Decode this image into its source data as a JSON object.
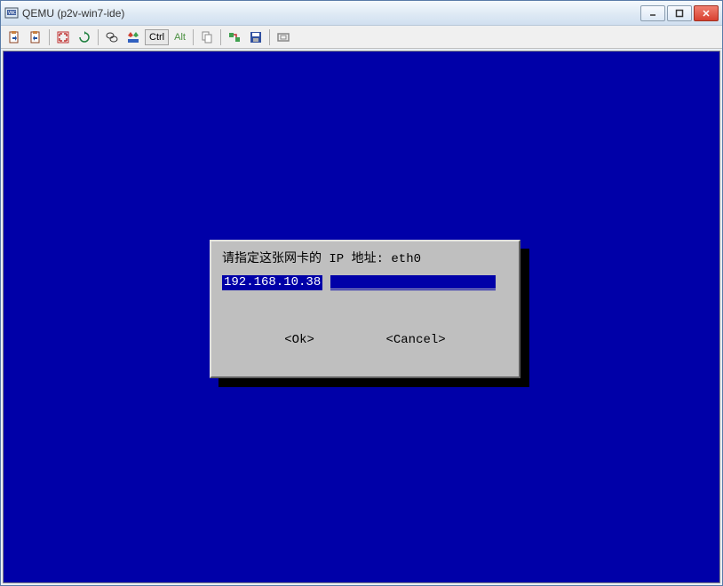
{
  "window": {
    "title": "QEMU (p2v-win7-ide)"
  },
  "toolbar": {
    "ctrl_label": "Ctrl",
    "alt_label": "Alt"
  },
  "dialog": {
    "prompt": "请指定这张网卡的 IP 地址:  eth0",
    "input_value": "192.168.10.38",
    "ok_label": "<Ok>",
    "cancel_label": "<Cancel>"
  }
}
